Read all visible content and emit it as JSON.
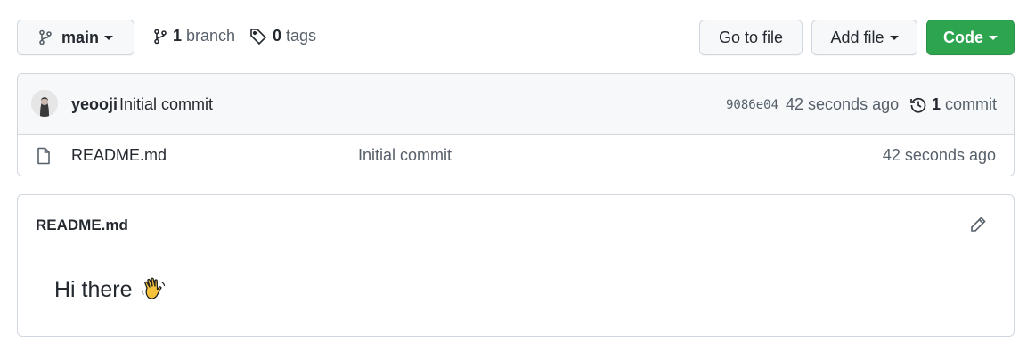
{
  "toolbar": {
    "branch_label": "main",
    "branch_count": "1",
    "branch_word": "branch",
    "tag_count": "0",
    "tag_word": "tags",
    "goto_label": "Go to file",
    "add_label": "Add file",
    "code_label": "Code"
  },
  "commit": {
    "author": "yeooji",
    "message": "Initial commit",
    "sha": "9086e04",
    "time": "42 seconds ago",
    "count": "1",
    "count_word": "commit"
  },
  "files": [
    {
      "name": "README.md",
      "message": "Initial commit",
      "time": "42 seconds ago",
      "icon": "file-icon"
    }
  ],
  "readme": {
    "title": "README.md",
    "heading": "Hi there",
    "emoji": "waving-hand"
  },
  "colors": {
    "accent": "#2da44e",
    "border": "#d0d7de",
    "muted": "#57606a"
  }
}
